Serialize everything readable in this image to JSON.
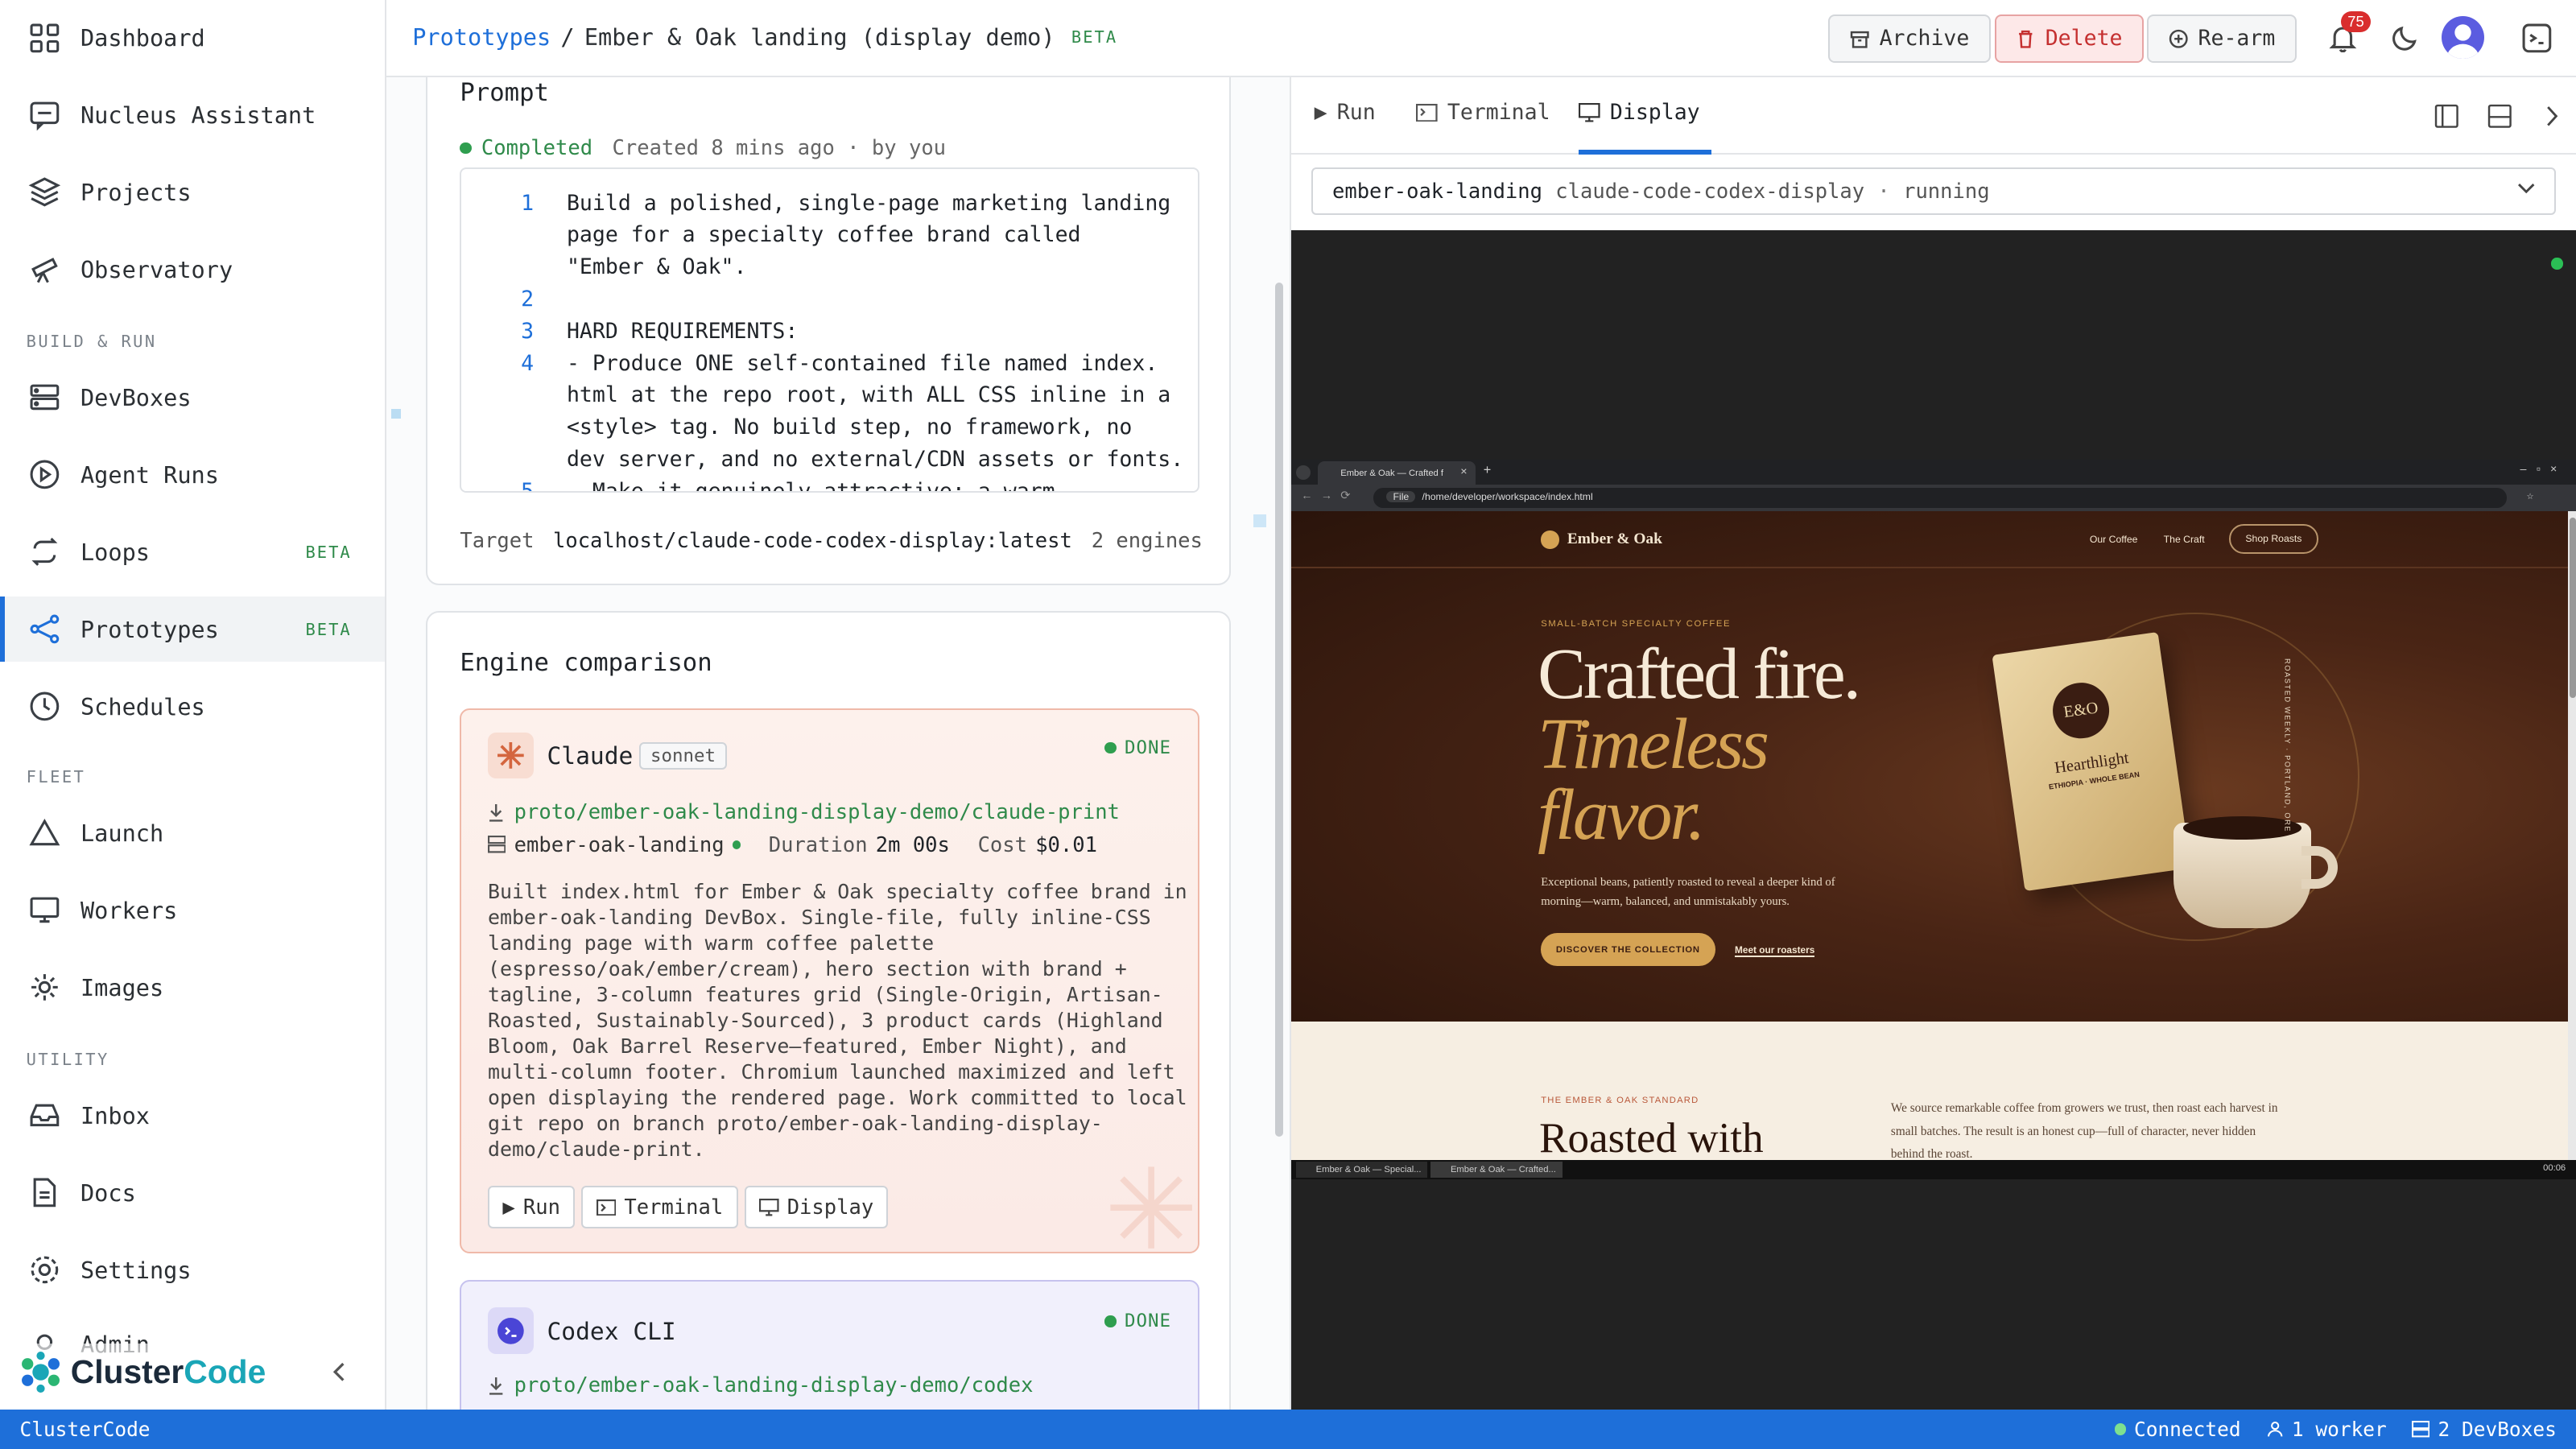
{
  "sidebar": {
    "items": [
      {
        "label": "Dashboard",
        "icon": "grid-icon"
      },
      {
        "label": "Nucleus Assistant",
        "icon": "chat-icon"
      },
      {
        "label": "Projects",
        "icon": "layers-icon"
      },
      {
        "label": "Observatory",
        "icon": "telescope-icon"
      },
      {
        "label": "DevBoxes",
        "icon": "server-icon"
      },
      {
        "label": "Agent Runs",
        "icon": "play-circle-icon"
      },
      {
        "label": "Loops",
        "icon": "loop-icon",
        "badge": "BETA"
      },
      {
        "label": "Prototypes",
        "icon": "share-icon",
        "badge": "BETA"
      },
      {
        "label": "Schedules",
        "icon": "clock-icon"
      },
      {
        "label": "Launch",
        "icon": "triangle-icon"
      },
      {
        "label": "Workers",
        "icon": "monitor-icon"
      },
      {
        "label": "Images",
        "icon": "gear-icon"
      },
      {
        "label": "Inbox",
        "icon": "inbox-icon"
      },
      {
        "label": "Docs",
        "icon": "doc-icon"
      },
      {
        "label": "Settings",
        "icon": "settings-icon"
      },
      {
        "label": "Admin",
        "icon": "admin-icon"
      }
    ],
    "sections": {
      "build": "BUILD & RUN",
      "fleet": "FLEET",
      "utility": "UTILITY"
    },
    "brand": "ClusterCode",
    "brand_cluster": "Cluster",
    "brand_code": "Code"
  },
  "header": {
    "breadcrumb_root": "Prototypes",
    "separator": "/",
    "title": "Ember & Oak landing (display demo)",
    "tag": "BETA",
    "archive": "Archive",
    "delete": "Delete",
    "rearm": "Re-arm",
    "notification_count": "75"
  },
  "prompt": {
    "heading": "Prompt",
    "status": "Completed",
    "meta": "Created 8 mins ago · by you",
    "lines": {
      "n1": "1",
      "n2": "2",
      "n3": "3",
      "n4": "4",
      "n5": "5",
      "l1a": "Build a polished, single-page marketing landing",
      "l1b": "page for a specialty coffee brand called",
      "l1c": "\"Ember & Oak\".",
      "l3": "HARD REQUIREMENTS:",
      "l4a": "- Produce ONE self-contained file named index.",
      "l4b": "html at the repo root, with ALL CSS inline in a",
      "l4c": "<style> tag. No build step, no framework, no",
      "l4d": "dev server, and no external/CDN assets or fonts.",
      "l5": "- Make it genuinely attractive: a warm"
    },
    "target_label": "Target",
    "target": "localhost/claude-code-codex-display:latest",
    "engines": "2 engines"
  },
  "comparison": {
    "heading": "Engine comparison",
    "claude": {
      "name": "Claude",
      "model": "sonnet",
      "status": "DONE",
      "branch": "proto/ember-oak-landing-display-demo/claude-print",
      "devbox": "ember-oak-landing",
      "duration_label": "Duration",
      "duration": "2m 00s",
      "cost_label": "Cost",
      "cost": "$0.01",
      "summary": [
        "Built index.html for Ember & Oak specialty coffee brand in",
        "ember-oak-landing DevBox. Single-file, fully inline-CSS",
        "landing page with warm coffee palette",
        "(espresso/oak/ember/cream), hero section with brand +",
        "tagline, 3-column features grid (Single-Origin, Artisan-",
        "Roasted, Sustainably-Sourced), 3 product cards (Highland",
        "Bloom, Oak Barrel Reserve—featured, Ember Night), and",
        "multi-column footer. Chromium launched maximized and left",
        "open displaying the rendered page. Work committed to local",
        "git repo on branch proto/ember-oak-landing-display-",
        "demo/claude-print."
      ],
      "run": "Run",
      "terminal": "Terminal",
      "display": "Display"
    },
    "codex": {
      "name": "Codex CLI",
      "status": "DONE",
      "branch": "proto/ember-oak-landing-display-demo/codex"
    }
  },
  "panel": {
    "tabs": [
      "Run",
      "Terminal",
      "Display"
    ],
    "active_tab": "Display",
    "box_name": "ember-oak-landing",
    "box_image": "claude-code-codex-display",
    "box_sep": "·",
    "box_state": "running"
  },
  "browser": {
    "tab_title": "Ember & Oak — Crafted f",
    "url_prefix": "File",
    "url": "/home/developer/workspace/index.html",
    "task1": "Ember & Oak — Special...",
    "task2": "Ember & Oak — Crafted...",
    "clock": "00:06"
  },
  "site": {
    "logo": "Ember & Oak",
    "nav": [
      "Our Coffee",
      "The Craft"
    ],
    "nav_cta": "Shop Roasts",
    "eyebrow": "SMALL-BATCH SPECIALTY COFFEE",
    "headline1": "Crafted fire.",
    "headline2": "Timeless",
    "headline3": "flavor.",
    "body1": "Exceptional beans, patiently roasted to reveal a deeper kind of",
    "body2": "morning—warm, balanced, and unmistakably yours.",
    "cta_primary": "DISCOVER THE COLLECTION",
    "cta_link": "Meet our roasters",
    "bag_mark": "E&O",
    "bag_name": "Hearthlight",
    "bag_sub": "ETHIOPIA · WHOLE BEAN",
    "side_text": "ROASTED WEEKLY · PORTLAND, ORE",
    "section_eyebrow": "THE EMBER & OAK STANDARD",
    "section_title": "Roasted with",
    "section_body1": "We source remarkable coffee from growers we trust, then roast each harvest in",
    "section_body2": "small batches. The result is an honest cup—full of character, never hidden",
    "section_body3": "behind the roast."
  },
  "statusbar": {
    "app": "ClusterCode",
    "connected": "Connected",
    "workers": "1 worker",
    "devboxes": "2 DevBoxes"
  },
  "colors": {
    "accent": "#1e6fd9",
    "danger": "#c53030",
    "success": "#2f9e4f",
    "espresso": "#3a1d12",
    "gold": "#d5a354"
  }
}
